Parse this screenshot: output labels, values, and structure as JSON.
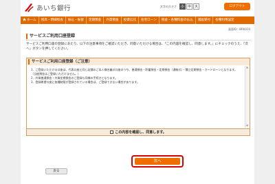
{
  "header": {
    "bank_name": "あいち銀行",
    "font_size_label": "文字の大きさ",
    "font_size_options": [
      "小",
      "中",
      "大"
    ],
    "logout_label": "ログアウト"
  },
  "nav": {
    "items": [
      "ホーム",
      "残高・明細照会",
      "振込・振替",
      "定期預金",
      "外貨預金",
      "投資信託",
      "住宅ローン",
      "税金・各種料金の払込",
      "諸届受付",
      "各種利用設定"
    ]
  },
  "screen_id": "画面ID：BRK010",
  "section_title": "サービスご利用口座登録",
  "intro_text": "サービスご利用口座の登録にあたり、以下の注意事項をご確認いただき、同意いただける場合は、「この内容を確認し、同意します。」にチェックのうえ、「次へ」ボタンを押してください。",
  "terms": {
    "title": "サービスご利用口座登録（ご注意）",
    "items": [
      "1．ご登録いただける口座は、代表口座と同じ店舗のご本人様名義の口座のうち、普通預金・貯蓄預金・定期預金（通帳式）・積立定期預金・カードローンとなります。（当座預金はご登録いただけません。）",
      "2．外貨普通預金・外貨定期預金のご登録も同様の手続きとなります。",
      "3．登録希望口座に各種制限が登録されている場合は、ご登録できない場合があります。"
    ]
  },
  "agree_label": "この内容を確認し、同意します。",
  "next_label": "次へ",
  "back_label": "戻る",
  "colors": {
    "brand_orange": "#e06a00",
    "button_orange": "#f06e00",
    "highlight_red": "#d60000"
  }
}
